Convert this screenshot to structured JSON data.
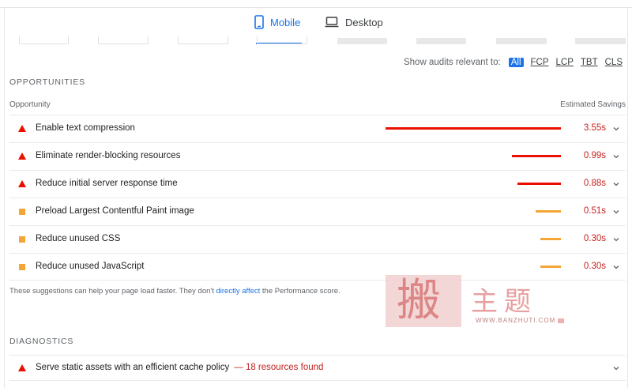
{
  "tabs": [
    {
      "label": "Mobile",
      "active": true,
      "icon": "mobile-phone-icon"
    },
    {
      "label": "Desktop",
      "active": false,
      "icon": "laptop-icon"
    }
  ],
  "filter": {
    "label": "Show audits relevant to:",
    "options": [
      "All",
      "FCP",
      "LCP",
      "TBT",
      "CLS"
    ],
    "active": "All"
  },
  "opportunities": {
    "title": "OPPORTUNITIES",
    "col_left": "Opportunity",
    "col_right": "Estimated Savings",
    "items": [
      {
        "title": "Enable text compression",
        "savings": "3.55s",
        "savings_s": 3.55,
        "severity": "fail"
      },
      {
        "title": "Eliminate render-blocking resources",
        "savings": "0.99s",
        "savings_s": 0.99,
        "severity": "fail"
      },
      {
        "title": "Reduce initial server response time",
        "savings": "0.88s",
        "savings_s": 0.88,
        "severity": "fail"
      },
      {
        "title": "Preload Largest Contentful Paint image",
        "savings": "0.51s",
        "savings_s": 0.51,
        "severity": "average"
      },
      {
        "title": "Reduce unused CSS",
        "savings": "0.30s",
        "savings_s": 0.3,
        "severity": "average"
      },
      {
        "title": "Reduce unused JavaScript",
        "savings": "0.30s",
        "savings_s": 0.3,
        "severity": "average"
      }
    ],
    "note_before": "These suggestions can help your page load faster. They don't ",
    "note_link": "directly affect",
    "note_after": " the Performance score."
  },
  "diagnostics": {
    "title": "DIAGNOSTICS",
    "items": [
      {
        "title": "Serve static assets with an efficient cache policy",
        "detail": "— 18 resources found",
        "severity": "fail"
      }
    ]
  },
  "colors": {
    "accent": "#1a73e8",
    "fail": "#eb0f00",
    "average": "#f4a536",
    "savings_text": "#c5221f"
  },
  "watermark": {
    "seal_char": "搬",
    "text": "主题",
    "url": "WWW.BANZHUTI.COM"
  }
}
